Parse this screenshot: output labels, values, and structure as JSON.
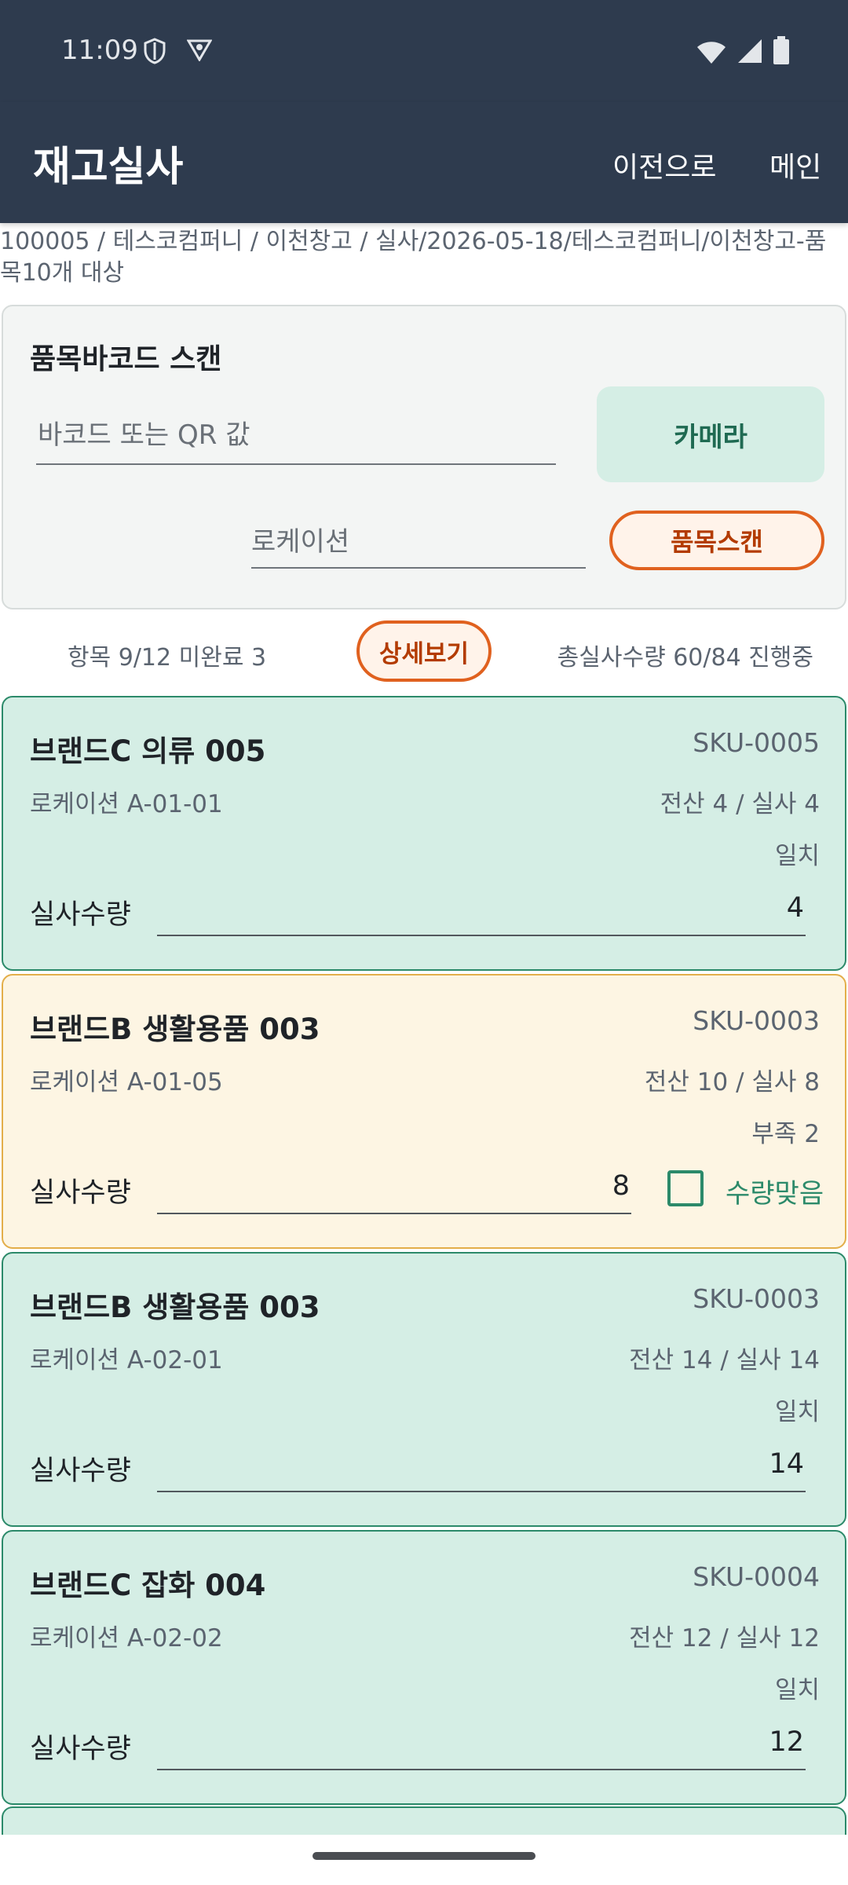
{
  "status_bar": {
    "time": "11:09",
    "left_icons": [
      "shield-icon",
      "vpn-icon"
    ],
    "right_icons": [
      "wifi-icon",
      "signal-icon",
      "battery-icon"
    ]
  },
  "app_bar": {
    "title": "재고실사",
    "back_label": "이전으로",
    "main_label": "메인",
    "background_color": "#2e3b4e"
  },
  "breadcrumb": "100005 / 테스코컴퍼니 / 이천창고 / 실사/2026-05-18/테스코컴퍼니/이천창고-품목10개 대상",
  "scan": {
    "title": "품목바코드 스캔",
    "barcode_placeholder": "바코드 또는 QR 값",
    "camera_label": "카메라",
    "location_placeholder": "로케이션",
    "item_scan_label": "품목스캔"
  },
  "summary": {
    "items_text": "항목 9/12 미완료 3",
    "detail_label": "상세보기",
    "total_text": "총실사수량 60/84 진행중"
  },
  "cards": [
    {
      "name": "브랜드C 의류 005",
      "sku": "SKU-0005",
      "location": "로케이션 A-01-01",
      "qty_text": "전산 4 / 실사 4",
      "status": "일치",
      "input_label": "실사수량",
      "value": "4",
      "state": "match"
    },
    {
      "name": "브랜드B 생활용품 003",
      "sku": "SKU-0003",
      "location": "로케이션 A-01-05",
      "qty_text": "전산 10 / 실사 8",
      "status": "부족 2",
      "input_label": "실사수량",
      "value": "8",
      "state": "short",
      "checkbox_label": "수량맞음",
      "checkbox_checked": false
    },
    {
      "name": "브랜드B 생활용품 003",
      "sku": "SKU-0003",
      "location": "로케이션 A-02-01",
      "qty_text": "전산 14 / 실사 14",
      "status": "일치",
      "input_label": "실사수량",
      "value": "14",
      "state": "match"
    },
    {
      "name": "브랜드C 잡화 004",
      "sku": "SKU-0004",
      "location": "로케이션 A-02-02",
      "qty_text": "전산 12 / 실사 12",
      "status": "일치",
      "input_label": "실사수량",
      "value": "12",
      "state": "match"
    }
  ],
  "colors": {
    "match_card_bg": "#d5eee5",
    "match_card_border": "#2c8a6a",
    "short_card_bg": "#fdf5e3",
    "short_card_border": "#e3ae4a",
    "accent_orange": "#e0611f"
  }
}
